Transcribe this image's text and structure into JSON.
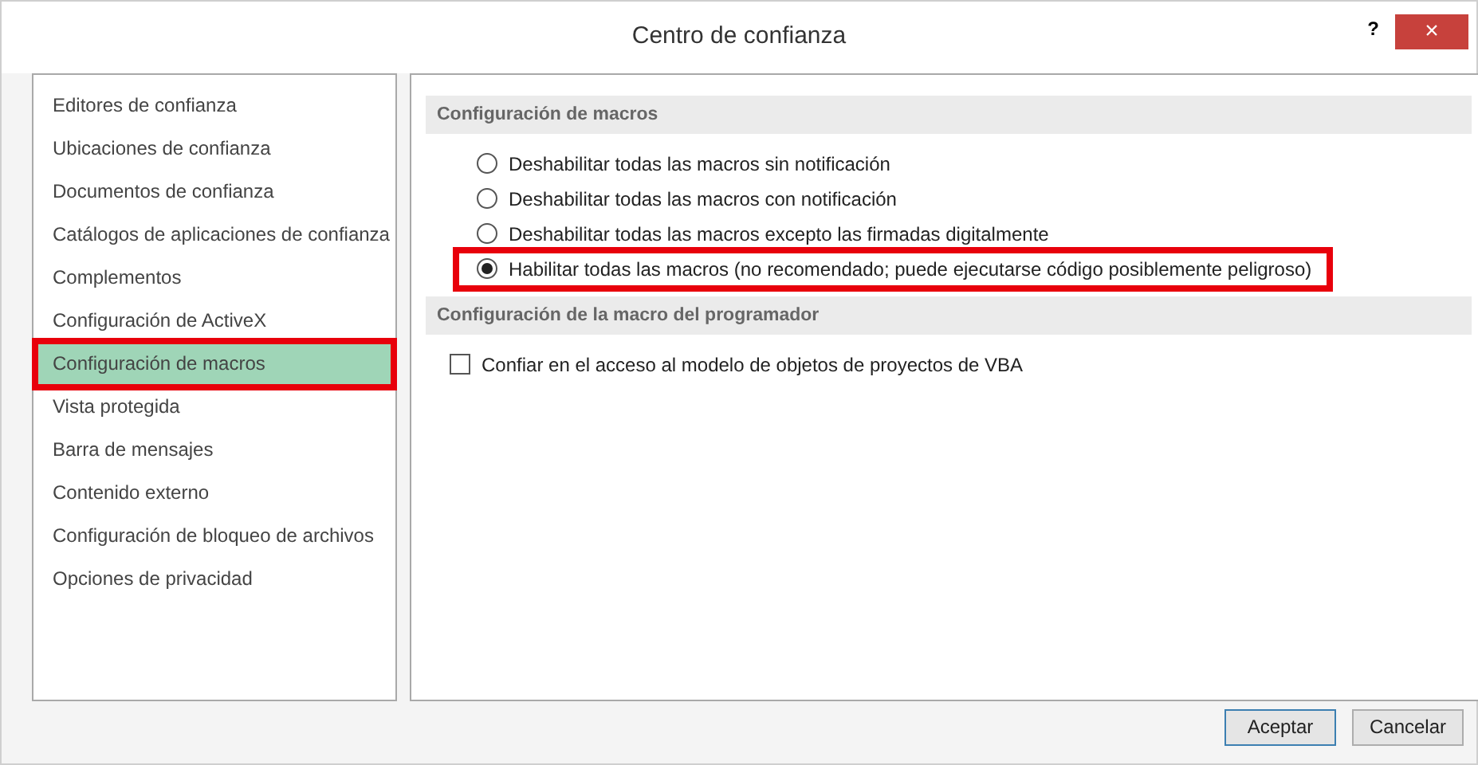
{
  "window": {
    "title": "Centro de confianza",
    "help": "?",
    "close": "×"
  },
  "sidebar": {
    "items": [
      {
        "label": "Editores de confianza",
        "selected": false,
        "annotated": false
      },
      {
        "label": "Ubicaciones de confianza",
        "selected": false,
        "annotated": false
      },
      {
        "label": "Documentos de confianza",
        "selected": false,
        "annotated": false
      },
      {
        "label": "Catálogos de aplicaciones de confianza",
        "selected": false,
        "annotated": false
      },
      {
        "label": "Complementos",
        "selected": false,
        "annotated": false
      },
      {
        "label": "Configuración de ActiveX",
        "selected": false,
        "annotated": false
      },
      {
        "label": "Configuración de macros",
        "selected": true,
        "annotated": true
      },
      {
        "label": "Vista protegida",
        "selected": false,
        "annotated": false
      },
      {
        "label": "Barra de mensajes",
        "selected": false,
        "annotated": false
      },
      {
        "label": "Contenido externo",
        "selected": false,
        "annotated": false
      },
      {
        "label": "Configuración de bloqueo de archivos",
        "selected": false,
        "annotated": false
      },
      {
        "label": "Opciones de privacidad",
        "selected": false,
        "annotated": false
      }
    ]
  },
  "sections": [
    {
      "title": "Configuración de macros",
      "options": [
        {
          "kind": "radio",
          "label": "Deshabilitar todas las macros sin notificación",
          "selected": false,
          "annotated": false
        },
        {
          "kind": "radio",
          "label": "Deshabilitar todas las macros con notificación",
          "selected": false,
          "annotated": false
        },
        {
          "kind": "radio",
          "label": "Deshabilitar todas las macros excepto las firmadas digitalmente",
          "selected": false,
          "annotated": false
        },
        {
          "kind": "radio",
          "label": "Habilitar todas las macros (no recomendado; puede ejecutarse código posiblemente peligroso)",
          "selected": true,
          "annotated": true
        }
      ]
    },
    {
      "title": "Configuración de la macro del programador",
      "options": [
        {
          "kind": "checkbox",
          "label": "Confiar en el acceso al modelo de objetos de proyectos de VBA",
          "checked": false,
          "annotated": false
        }
      ]
    }
  ],
  "buttons": [
    {
      "label": "Aceptar",
      "default": true
    },
    {
      "label": "Cancelar",
      "default": false
    }
  ]
}
